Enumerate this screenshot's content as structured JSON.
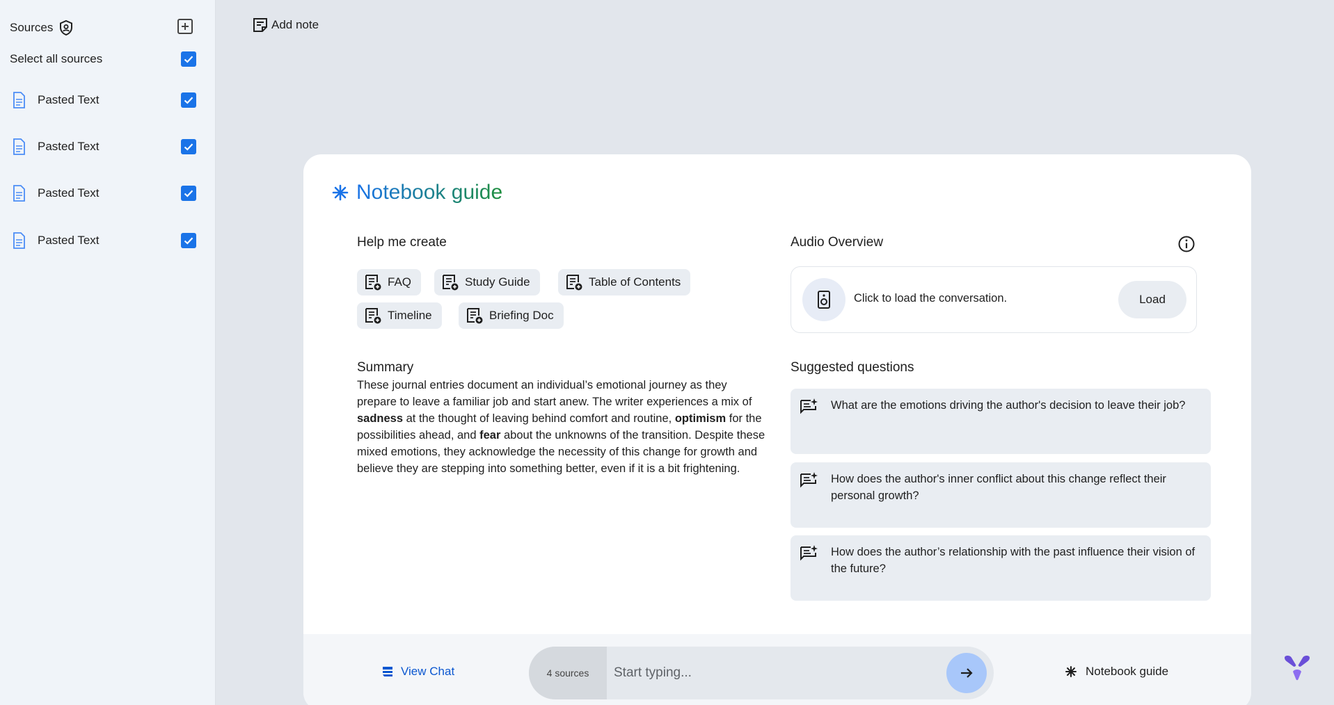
{
  "sidebar": {
    "title": "Sources",
    "select_all": "Select all sources",
    "items": [
      {
        "label": "Pasted Text"
      },
      {
        "label": "Pasted Text"
      },
      {
        "label": "Pasted Text"
      },
      {
        "label": "Pasted Text"
      }
    ]
  },
  "toolbar": {
    "add_note": "Add note"
  },
  "guide": {
    "title": "Notebook guide",
    "help_title": "Help me create",
    "chips": [
      "FAQ",
      "Study Guide",
      "Table of Contents",
      "Timeline",
      "Briefing Doc"
    ],
    "summary_title": "Summary",
    "summary": {
      "p1": "These journal entries document an individual’s emotional journey as they prepare to leave a familiar job and start anew. The writer experiences a mix of ",
      "b1": "sadness",
      "p2": " at the thought of leaving behind comfort and routine, ",
      "b2": "optimism",
      "p3": " for the possibilities ahead, and ",
      "b3": "fear",
      "p4": " about the unknowns of the transition. Despite these mixed emotions, they acknowledge the necessity of this change for growth and believe they are stepping into something better, even if it is a bit frightening."
    },
    "audio_title": "Audio Overview",
    "audio_text": "Click to load the conversation.",
    "load_label": "Load",
    "questions_title": "Suggested questions",
    "questions": [
      "What are the emotions driving the author's decision to leave their job?",
      "How does the author's inner conflict about this change reflect their personal growth?",
      "How does the author’s relationship with the past influence their vision of the future?"
    ]
  },
  "bottom": {
    "view_chat": "View Chat",
    "sources_count": "4 sources",
    "input_placeholder": "Start typing...",
    "notebook_guide": "Notebook guide"
  },
  "colors": {
    "accent": "#1a73e8",
    "title_gradient_start": "#1a73e8",
    "title_gradient_end": "#1e8e3e",
    "link": "#0b57d0"
  }
}
